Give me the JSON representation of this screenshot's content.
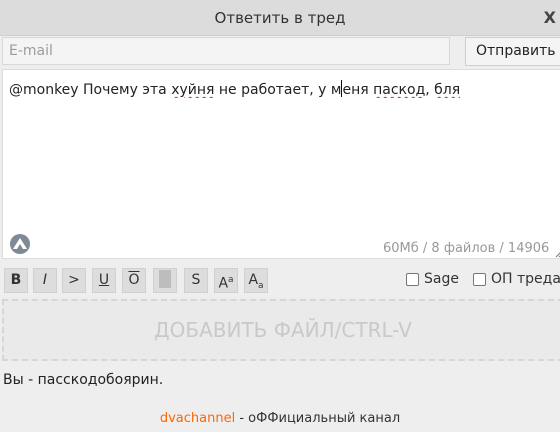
{
  "dialog": {
    "title": "Ответить в тред",
    "close_label": "X"
  },
  "email": {
    "placeholder": "E-mail",
    "value": ""
  },
  "send_button": {
    "label": "Отправить"
  },
  "comment": {
    "parts": [
      "@monkey Почему эта ",
      "хуйня",
      " не работает, у м",
      "еня ",
      "паскод",
      ", ",
      "бля"
    ]
  },
  "limits_text": "60Мб / 8 файлов / 14906",
  "toolbar": {
    "bold": "B",
    "italic": "I",
    "quote": ">",
    "underline": "U",
    "overline": "O",
    "strike": "S",
    "sup_base": "A",
    "sup_small": "a",
    "sub_base": "A",
    "sub_small": "a",
    "sage_label": "Sage",
    "op_label": "ОП треда"
  },
  "dropzone_text": "ДОБАВИТЬ ФАЙЛ/CTRL-V",
  "status_text": "Вы - пасскодобоярин.",
  "footer": {
    "link": "dvachannel",
    "rest": " - оФФициальный канал"
  },
  "colors": {
    "accent_link": "#ff6600",
    "spellcheck": "#e02020"
  },
  "icons": [
    "close-icon",
    "attach-logo-icon",
    "resize-grip-icon"
  ]
}
